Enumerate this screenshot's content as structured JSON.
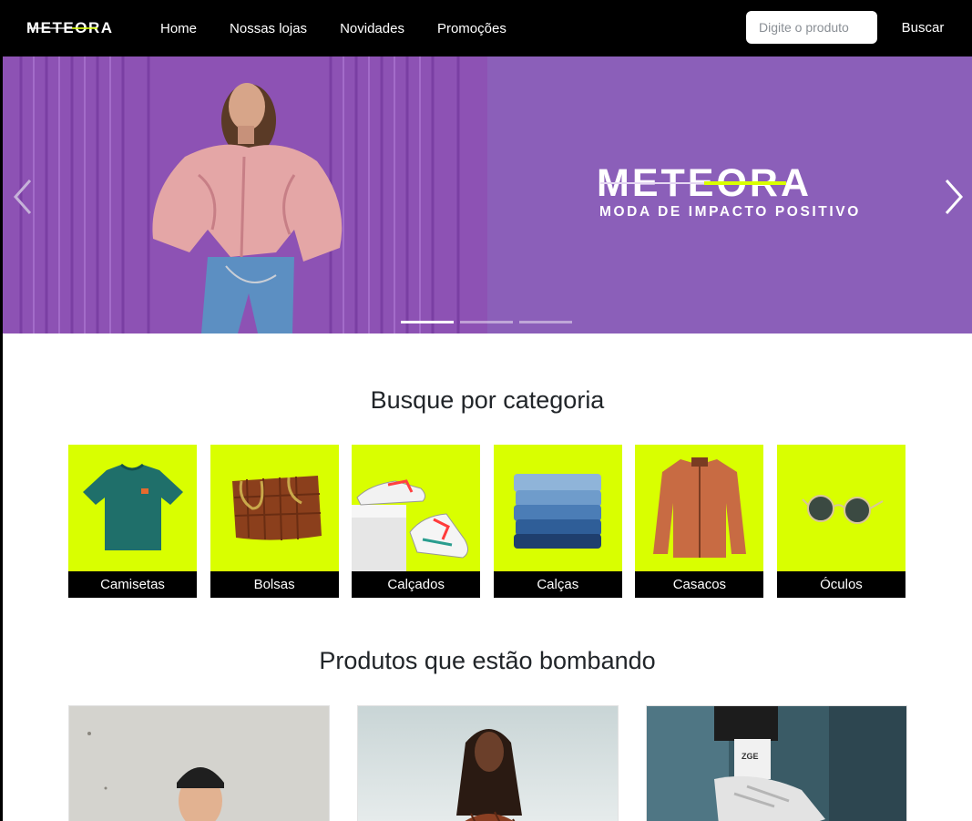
{
  "nav": {
    "brand": "METEORA",
    "links": [
      "Home",
      "Nossas lojas",
      "Novidades",
      "Promoções"
    ],
    "search_placeholder": "Digite o produto",
    "search_button": "Buscar"
  },
  "hero": {
    "logo_text": "METEORA",
    "tagline": "MODA DE IMPACTO POSITIVO",
    "slides_count": 3,
    "active_slide": 1
  },
  "categories": {
    "title": "Busque por categoria",
    "items": [
      {
        "label": "Camisetas",
        "icon": "tshirt-image"
      },
      {
        "label": "Bolsas",
        "icon": "bag-image"
      },
      {
        "label": "Calçados",
        "icon": "sneakers-image"
      },
      {
        "label": "Calças",
        "icon": "jeans-image"
      },
      {
        "label": "Casacos",
        "icon": "jacket-image"
      },
      {
        "label": "Óculos",
        "icon": "sunglasses-image"
      }
    ]
  },
  "products": {
    "title": "Produtos que estão bombando"
  },
  "colors": {
    "accent": "#d9ff00",
    "hero_bg": "#8b5fb9",
    "nav_bg": "#000000"
  }
}
